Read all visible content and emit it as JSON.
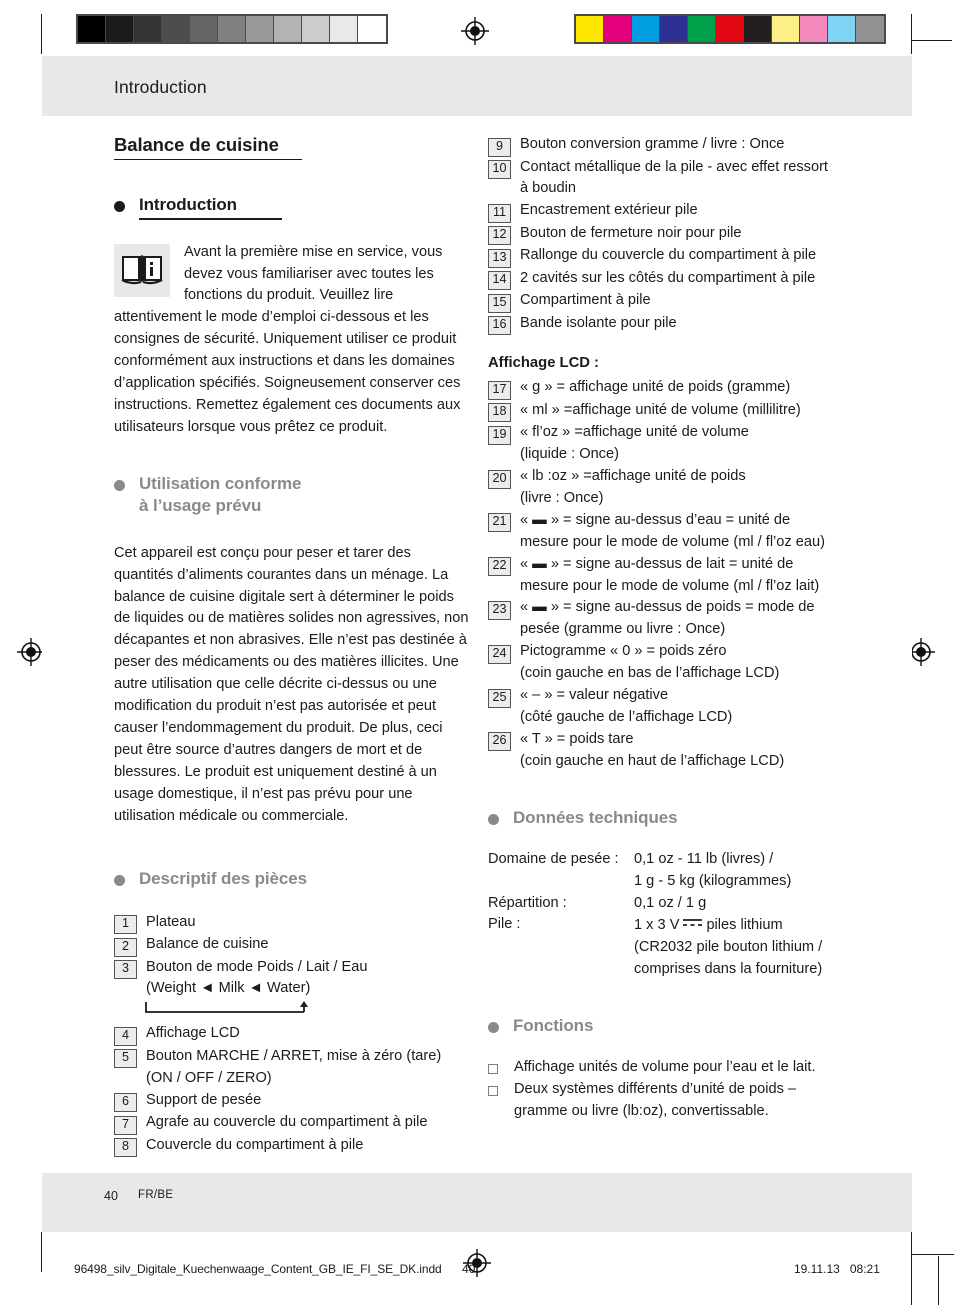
{
  "print_marks": {
    "grayscale_steps": [
      "#000000",
      "#1b1b1b",
      "#333333",
      "#4d4d4d",
      "#666666",
      "#808080",
      "#999999",
      "#b3b3b3",
      "#cccccc",
      "#e9e9e9",
      "#ffffff"
    ],
    "color_steps": [
      "#ffe800",
      "#e5007d",
      "#00a0e3",
      "#2e3192",
      "#00a14b",
      "#e30613",
      "#231f20",
      "#fbef85",
      "#f589be",
      "#7fd4f4",
      "#939393"
    ],
    "registration_icon": "registration-target-icon"
  },
  "header": {
    "title": "Introduction"
  },
  "footer": {
    "page_number": "40",
    "language": "FR/BE"
  },
  "imprint": {
    "filename": "96498_silv_Digitale_Kuechenwaage_Content_GB_IE_FI_SE_DK.indd",
    "page": "40",
    "date": "19.11.13",
    "time": "08:21"
  },
  "left_column": {
    "doc_title": "Balance de cuisine",
    "intro": {
      "heading": "Introduction",
      "icon": "open-book-info-icon",
      "paragraph": "Avant la première mise en service, vous devez vous familiariser avec toutes les fonctions du produit. Veuillez lire attentivement le mode d’emploi ci-dessous et les consignes de sécurité. Uniquement utiliser ce produit conformément aux instructions et dans les domaines d’application spécifiés. Soigneusement conserver ces instructions. Remettez également ces documents aux utilisateurs lorsque vous prêtez ce produit."
    },
    "intended_use": {
      "heading_line1": "Utilisation conforme",
      "heading_line2": "à l’usage prévu",
      "paragraph": "Cet appareil est conçu pour peser et tarer des quantités d’aliments courantes dans un ménage. La balance de cuisine digitale sert à déterminer le poids de liquides ou de matières solides non agressives, non décapantes et non abrasives. Elle n’est pas destinée à peser des médicaments ou des matières illicites. Une autre utilisation que celle décrite ci-dessus ou une modification du produit n’est pas autorisée et peut causer l’endommagement du produit. De plus, ceci peut être source d’autres dangers de mort et de blessures. Le produit est uniquement destiné à un usage domestique, il n’est pas prévu pour une utilisation médicale ou commerciale."
    },
    "parts": {
      "heading": "Descriptif des pièces",
      "items": [
        {
          "num": "1",
          "text": "Plateau"
        },
        {
          "num": "2",
          "text": "Balance de cuisine"
        },
        {
          "num": "3",
          "text": "Bouton de mode Poids / Lait / Eau\n(Weight ◄ Milk ◄ Water)"
        },
        {
          "num": "4",
          "text": "Affichage LCD"
        },
        {
          "num": "5",
          "text": "Bouton MARCHE / ARRET, mise à zéro (tare)\n(ON / OFF / ZERO)"
        },
        {
          "num": "6",
          "text": "Support de pesée"
        },
        {
          "num": "7",
          "text": "Agrafe au couvercle du compartiment à pile"
        },
        {
          "num": "8",
          "text": "Couvercle du compartiment à pile"
        }
      ]
    }
  },
  "right_column": {
    "parts_continued": [
      {
        "num": "9",
        "text": "Bouton conversion gramme / livre : Once"
      },
      {
        "num": "10",
        "text": "Contact métallique de la pile - avec effet ressort\nà boudin"
      },
      {
        "num": "11",
        "text": "Encastrement extérieur pile"
      },
      {
        "num": "12",
        "text": "Bouton de fermeture noir pour pile"
      },
      {
        "num": "13",
        "text": "Rallonge du couvercle du compartiment à pile"
      },
      {
        "num": "14",
        "text": "2 cavités sur les côtés du compartiment à pile"
      },
      {
        "num": "15",
        "text": "Compartiment à pile"
      },
      {
        "num": "16",
        "text": "Bande isolante pour pile"
      }
    ],
    "lcd": {
      "heading": "Affichage LCD :",
      "items": [
        {
          "num": "17",
          "text": "« g » = affichage unité de poids (gramme)"
        },
        {
          "num": "18",
          "text": "« ml » =affichage unité de volume (millilitre)"
        },
        {
          "num": "19",
          "text": "« fl’oz » =affichage unité de volume\n(liquide : Once)"
        },
        {
          "num": "20",
          "text": "« lb :oz » =affichage unité de poids\n(livre : Once)"
        },
        {
          "num": "21",
          "text": "« ▬ » = signe au-dessus d’eau = unité de\nmesure pour le mode de volume (ml / fl’oz eau)"
        },
        {
          "num": "22",
          "text": "« ▬ » = signe au-dessus de lait = unité de\nmesure pour le mode de volume (ml / fl’oz lait)"
        },
        {
          "num": "23",
          "text": "« ▬ » = signe au-dessus de poids = mode de\npesée (gramme ou livre : Once)"
        },
        {
          "num": "24",
          "text": "Pictogramme « 0 » = poids zéro\n(coin gauche en bas de l’affichage LCD)"
        },
        {
          "num": "25",
          "text": "« – » = valeur négative\n(côté gauche de l’affichage LCD)"
        },
        {
          "num": "26",
          "text": "« T » = poids tare\n(coin gauche en haut de l’affichage LCD)"
        }
      ]
    },
    "tech": {
      "heading": "Données techniques",
      "rows": [
        {
          "key": "Domaine de pesée :",
          "value": "0,1 oz - 11 lb (livres) /"
        },
        {
          "key": "",
          "value": "1 g - 5 kg (kilogrammes)"
        },
        {
          "key": "Répartition :",
          "value": "0,1 oz / 1 g"
        },
        {
          "key": "Pile :",
          "value": "1 x 3 V",
          "value_after_symbol": "piles lithium",
          "symbol": "dc-current-icon"
        },
        {
          "key": "",
          "value": "(CR2032 pile bouton lithium /"
        },
        {
          "key": "",
          "value": "comprises dans la fourniture)"
        }
      ]
    },
    "functions": {
      "heading": "Fonctions",
      "items": [
        "Affichage unités de volume pour l’eau et le lait.",
        "Deux systèmes différents d’unité de poids –\ngramme ou livre (lb:oz), convertissable."
      ]
    }
  }
}
